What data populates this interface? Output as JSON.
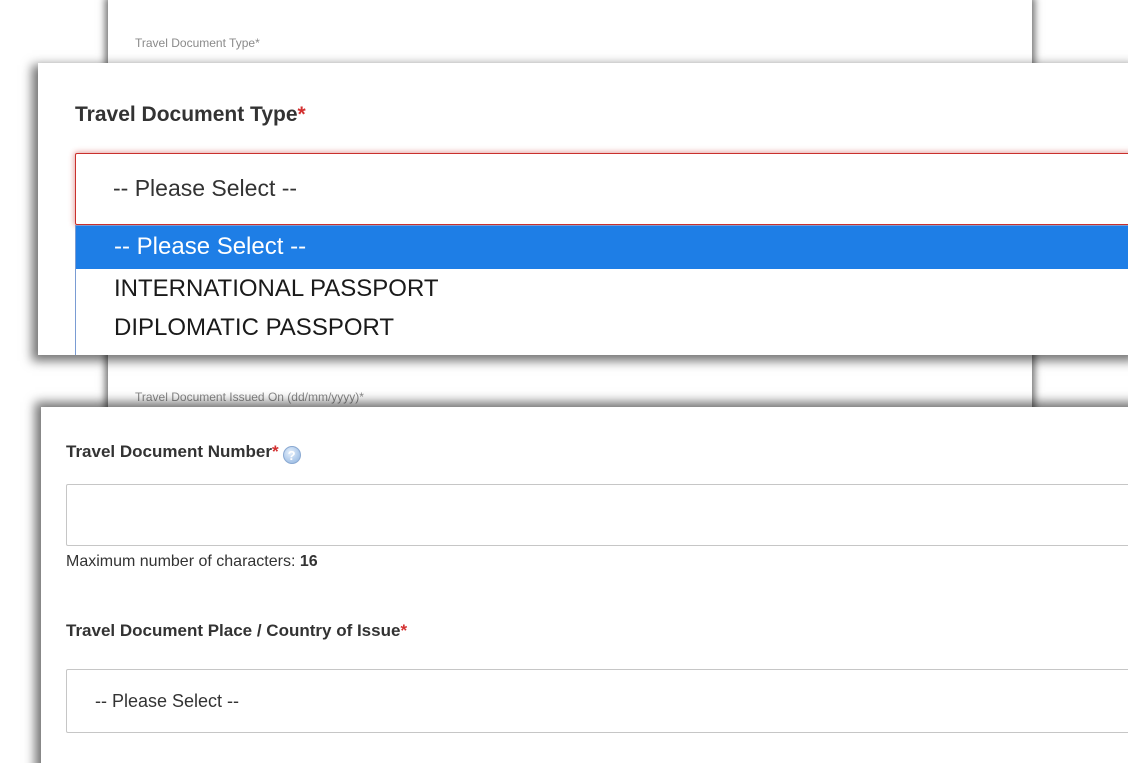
{
  "background_form": {
    "doc_type_label": "Travel Document Type",
    "issued_on_label": "Travel Document Issued On (dd/mm/yyyy)",
    "required_marker": "*"
  },
  "doc_type": {
    "label": "Travel Document Type",
    "required_marker": "*",
    "selected_value": "-- Please Select --",
    "options": [
      "-- Please Select --",
      "INTERNATIONAL PASSPORT",
      "DIPLOMATIC PASSPORT"
    ],
    "highlighted_index": 0
  },
  "doc_number": {
    "label": "Travel Document Number",
    "required_marker": "*",
    "help_icon": "question-circle-icon",
    "value": "",
    "hint_prefix": "Maximum number of characters: ",
    "max_chars": "16"
  },
  "country": {
    "label": "Travel Document Place / Country of Issue",
    "required_marker": "*",
    "selected_value": "-- Please Select --"
  },
  "colors": {
    "required": "#d32f2f",
    "highlight": "#1e7ee6",
    "error_border": "#c9302c"
  }
}
